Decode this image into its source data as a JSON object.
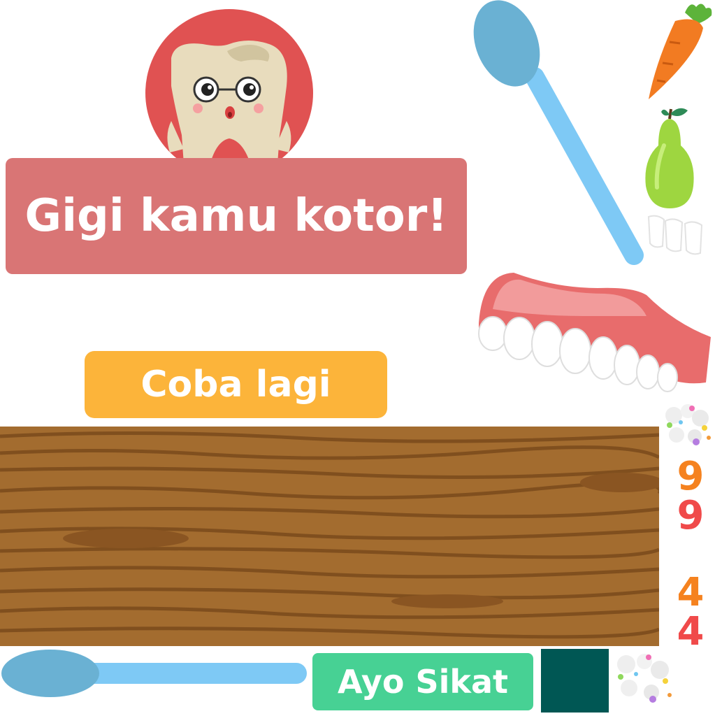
{
  "message": {
    "text": "Gigi kamu kotor!"
  },
  "buttons": {
    "retry_label": "Coba lagi",
    "brush_label": "Ayo Sikat"
  },
  "digits": {
    "top_orange": "9",
    "top_red": "9",
    "bottom_orange": "4",
    "bottom_red": "4"
  },
  "colors": {
    "banner": "#d97575",
    "retry": "#fcb43a",
    "brush": "#47d194",
    "square": "#005754",
    "digit_orange": "#f5821f",
    "digit_red": "#f04a4a"
  }
}
